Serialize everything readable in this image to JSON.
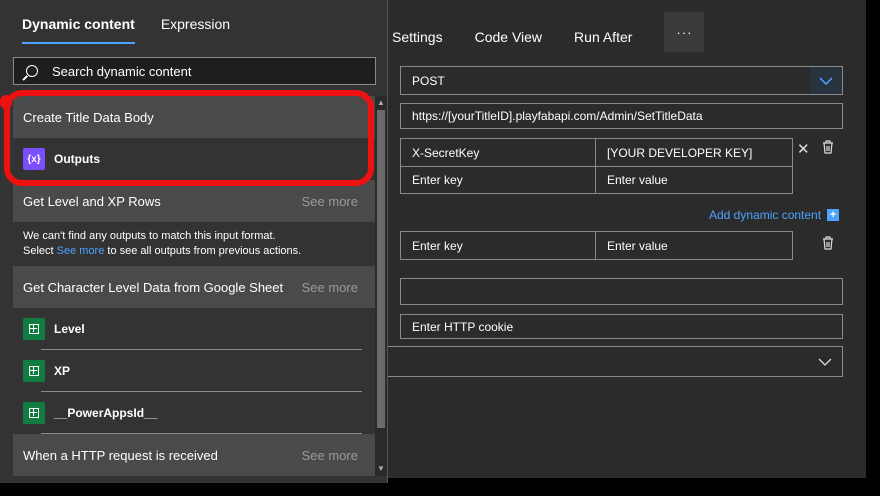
{
  "main": {
    "tabs": [
      "Settings",
      "Code View",
      "Run After"
    ],
    "more_label": "···",
    "method": "POST",
    "uri": "https://[yourTitleID].playfabapi.com/Admin/SetTitleData",
    "headers": [
      {
        "key": "X-SecretKey",
        "value": "[YOUR DEVELOPER KEY]"
      },
      {
        "key": "Enter key",
        "value": "Enter value"
      }
    ],
    "add_dynamic_label": "Add dynamic content",
    "queries": [
      {
        "key": "Enter key",
        "value": "Enter value"
      }
    ],
    "body_value": "",
    "cookie_placeholder": "Enter HTTP cookie",
    "auth_value": ""
  },
  "popup": {
    "tabs": [
      "Dynamic content",
      "Expression"
    ],
    "active_tab": "Dynamic content",
    "search_placeholder": "Search dynamic content",
    "sections": [
      {
        "title": "Create Title Data Body",
        "see_more": "",
        "items": [
          "Outputs"
        ]
      },
      {
        "title": "Get Level and XP Rows",
        "see_more": "See more",
        "note_a": "We can't find any outputs to match this input format.",
        "note_b1": "Select ",
        "note_link": "See more",
        "note_b2": " to see all outputs from previous actions."
      },
      {
        "title": "Get Character Level Data from Google Sheet",
        "see_more": "See more",
        "items": [
          "Level",
          "XP",
          "__PowerAppsId__"
        ]
      },
      {
        "title": "When a HTTP request is received",
        "see_more": "See more"
      }
    ]
  },
  "colors": {
    "accent": "#4da3ff",
    "annotation": "#e11111",
    "sheet": "#107c41",
    "expression": "#7b4fff"
  }
}
